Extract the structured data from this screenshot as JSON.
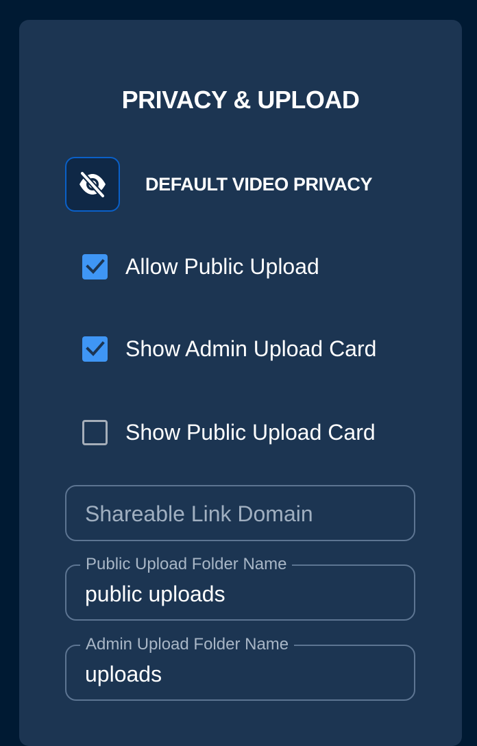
{
  "panel": {
    "title": "PRIVACY & UPLOAD"
  },
  "privacy": {
    "icon": "eye-slash-icon",
    "label": "DEFAULT VIDEO PRIVACY"
  },
  "checkboxes": [
    {
      "label": "Allow Public Upload",
      "checked": true
    },
    {
      "label": "Show Admin Upload Card",
      "checked": true
    },
    {
      "label": "Show Public Upload Card",
      "checked": false
    }
  ],
  "fields": {
    "shareable_domain": {
      "placeholder": "Shareable Link Domain",
      "value": ""
    },
    "public_folder": {
      "label": "Public Upload Folder Name",
      "value": "public uploads"
    },
    "admin_folder": {
      "label": "Admin Upload Folder Name",
      "value": "uploads"
    }
  },
  "colors": {
    "page_background": "#001a33",
    "panel_background": "#1c3552",
    "accent": "#3f96f5",
    "privacy_button_border": "#0a60c8"
  }
}
